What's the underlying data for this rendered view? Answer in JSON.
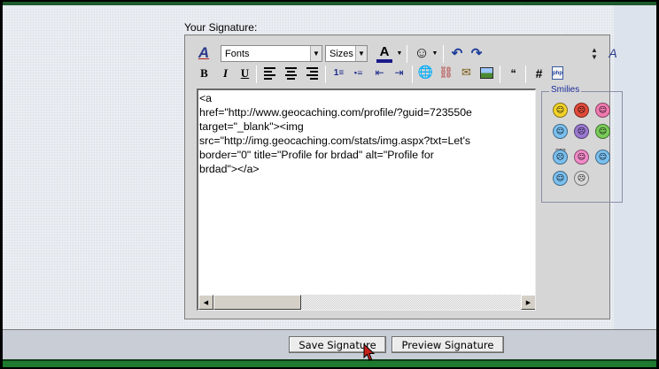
{
  "signature_label": "Your Signature:",
  "toolbar": {
    "fonts": "Fonts",
    "sizes": "Sizes",
    "bold": "B",
    "italic": "I",
    "underline": "U",
    "hash": "#",
    "font_color_letter": "A",
    "font_color": "#1a1a8a"
  },
  "textarea": {
    "value": "<a\nhref=\"http://www.geocaching.com/profile/?guid=723550e\ntarget=\"_blank\"><img\nsrc=\"http://img.geocaching.com/stats/img.aspx?txt=Let's\nborder=\"0\" title=\"Profile for brdad\" alt=\"Profile for\nbrdad\"></a>"
  },
  "smilies": {
    "title": "Smilies",
    "icons": [
      {
        "name": "smile-icon",
        "color": "#f2d22a",
        "face": "☺"
      },
      {
        "name": "angry-icon",
        "color": "#e04a3a",
        "face": "☹"
      },
      {
        "name": "tongue-icon",
        "color": "#f07ab0",
        "face": "☺"
      },
      {
        "name": "wink-icon",
        "color": "#7ac0f0",
        "face": "☺"
      },
      {
        "name": "sad-icon",
        "color": "#9a78d0",
        "face": "☹"
      },
      {
        "name": "grin-icon",
        "color": "#7acc5a",
        "face": "☺"
      },
      {
        "name": "confused-icon",
        "color": "#7ac0f0",
        "face": "☹"
      },
      {
        "name": "blush-icon",
        "color": "#f08ac8",
        "face": "☺"
      },
      {
        "name": "big-grin-icon",
        "color": "#7ac0f0",
        "face": "☺"
      },
      {
        "name": "cool-icon",
        "color": "#7ac0f0",
        "face": "☺"
      },
      {
        "name": "shocked-icon",
        "color": "#d8d8d8",
        "face": "☹"
      }
    ],
    "question_marks": "???"
  },
  "footer": {
    "save_label": "Save Signature",
    "preview_label": "Preview Signature"
  }
}
